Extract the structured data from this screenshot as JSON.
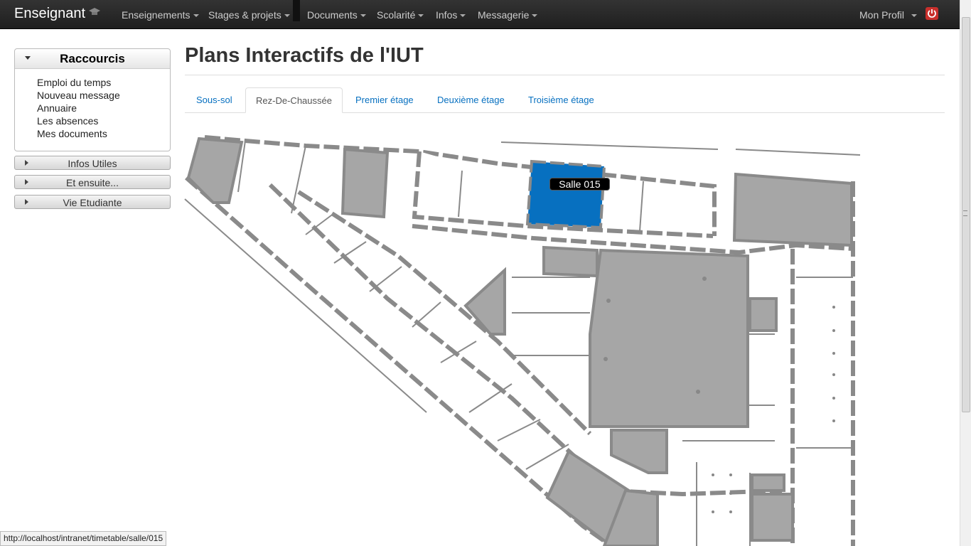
{
  "navbar": {
    "brand": "Enseignant",
    "items": [
      {
        "label": "Enseignements"
      },
      {
        "label": "Stages & projets"
      },
      {
        "label": "Documents"
      },
      {
        "label": "Scolarité"
      },
      {
        "label": "Infos"
      },
      {
        "label": "Messagerie"
      }
    ],
    "profile": "Mon Profil",
    "power_icon": "power-icon",
    "power_color": "#c9302c"
  },
  "sidebar": {
    "shortcuts_title": "Raccourcis",
    "shortcuts": [
      "Emploi du temps",
      "Nouveau message",
      "Annuaire",
      "Les absences",
      "Mes documents"
    ],
    "sections": [
      "Infos Utiles",
      "Et ensuite...",
      "Vie Etudiante"
    ]
  },
  "main": {
    "title": "Plans Interactifs de l'IUT",
    "tabs": [
      "Sous-sol",
      "Rez-De-Chaussée",
      "Premier étage",
      "Deuxième étage",
      "Troisième étage"
    ],
    "active_tab": "Rez-De-Chaussée",
    "map": {
      "tooltip": "Salle 015",
      "highlight_color": "#0770c0",
      "occupied_color": "#a6a6a6",
      "wall_color": "#8a8a8a"
    }
  },
  "statusbar": {
    "url": "http://localhost/intranet/timetable/salle/015"
  }
}
